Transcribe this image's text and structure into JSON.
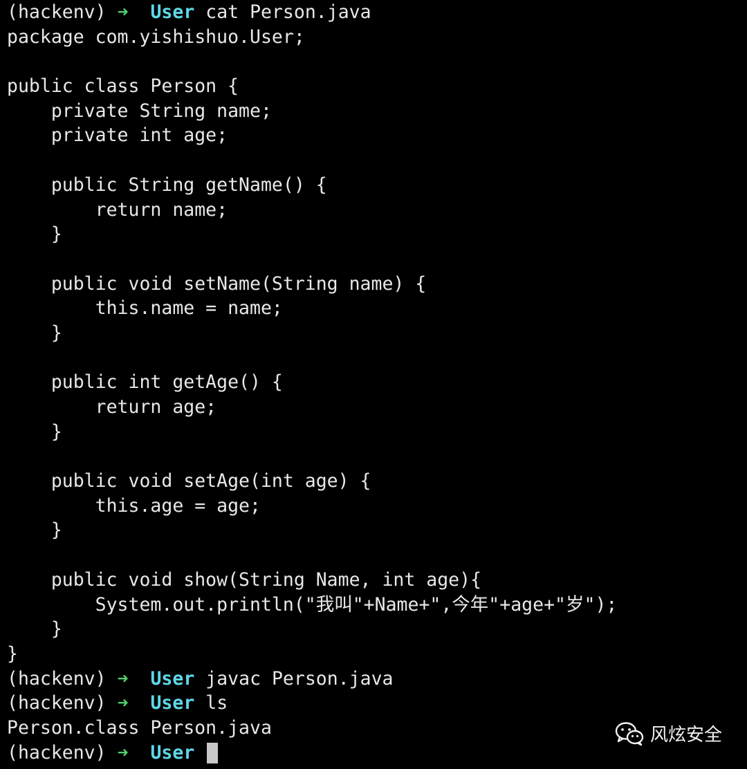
{
  "terminal": {
    "colors": {
      "background": "#000000",
      "text": "#e8e8e8",
      "prompt_arrow": "#4fd06b",
      "prompt_dir": "#5fd7e8"
    },
    "lines": [
      {
        "env": "(hackenv)",
        "arrow": "➜",
        "dir": "User",
        "cmd": "cat Person.java"
      },
      {
        "text": "package com.yishishuo.User;"
      },
      {
        "text": ""
      },
      {
        "text": "public class Person {"
      },
      {
        "text": "    private String name;"
      },
      {
        "text": "    private int age;"
      },
      {
        "text": ""
      },
      {
        "text": "    public String getName() {"
      },
      {
        "text": "        return name;"
      },
      {
        "text": "    }"
      },
      {
        "text": ""
      },
      {
        "text": "    public void setName(String name) {"
      },
      {
        "text": "        this.name = name;"
      },
      {
        "text": "    }"
      },
      {
        "text": ""
      },
      {
        "text": "    public int getAge() {"
      },
      {
        "text": "        return age;"
      },
      {
        "text": "    }"
      },
      {
        "text": ""
      },
      {
        "text": "    public void setAge(int age) {"
      },
      {
        "text": "        this.age = age;"
      },
      {
        "text": "    }"
      },
      {
        "text": ""
      },
      {
        "text": "    public void show(String Name, int age){"
      },
      {
        "text": "        System.out.println(\"我叫\"+Name+\",今年\"+age+\"岁\");"
      },
      {
        "text": "    }"
      },
      {
        "text": "}"
      },
      {
        "env": "(hackenv)",
        "arrow": "➜",
        "dir": "User",
        "cmd": "javac Person.java"
      },
      {
        "env": "(hackenv)",
        "arrow": "➜",
        "dir": "User",
        "cmd": "ls"
      },
      {
        "text": "Person.class Person.java"
      },
      {
        "env": "(hackenv)",
        "arrow": "➜",
        "dir": "User",
        "cmd": "",
        "cursor": true
      }
    ]
  },
  "watermark": {
    "icon": "wechat-icon",
    "text": "风炫安全"
  }
}
